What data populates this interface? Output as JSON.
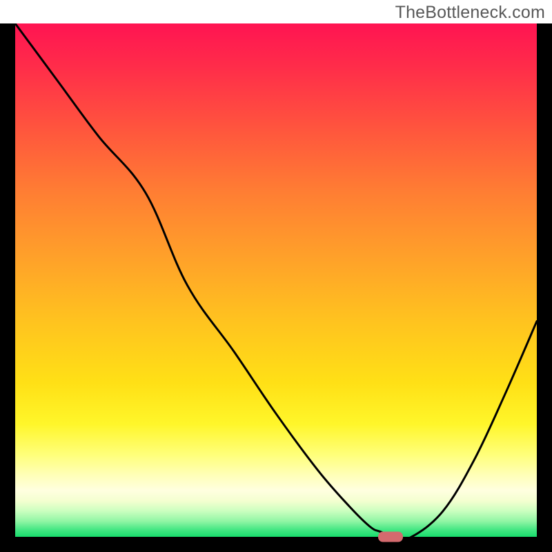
{
  "watermark": "TheBottleneck.com",
  "chart_data": {
    "type": "line",
    "title": "",
    "xlabel": "",
    "ylabel": "",
    "xlim": [
      0,
      100
    ],
    "ylim": [
      0,
      100
    ],
    "grid": false,
    "legend": false,
    "series": [
      {
        "name": "bottleneck-curve",
        "x": [
          0,
          8,
          16,
          25,
          33,
          42,
          50,
          58,
          64,
          68,
          70,
          73,
          76,
          82,
          88,
          94,
          100
        ],
        "y": [
          100,
          89,
          78,
          67,
          49,
          36,
          24,
          13,
          6,
          2,
          1,
          0,
          0,
          5,
          15,
          28,
          42
        ]
      }
    ],
    "marker": {
      "x": 72,
      "y": 0,
      "color": "#d46a6e"
    },
    "background_gradient": [
      "#ff1452",
      "#ffa229",
      "#fff62a",
      "#17dd6c"
    ]
  }
}
